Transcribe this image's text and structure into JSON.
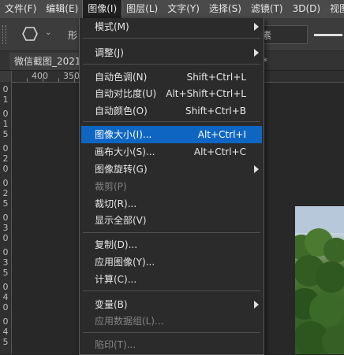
{
  "menubar": {
    "items": [
      "文件(F)",
      "编辑(E)",
      "图像(I)",
      "图层(L)",
      "文字(Y)",
      "选择(S)",
      "滤镜(T)",
      "3D(D)",
      "视图"
    ]
  },
  "options_bar": {
    "label_left": "形",
    "label_right": "素"
  },
  "document_tab": {
    "title": "微信截图_2021",
    "right_mark": "*"
  },
  "ruler": {
    "top": [
      "400",
      "350"
    ],
    "left": [
      "0",
      "1",
      "0",
      "1",
      "5",
      "0",
      "2",
      "0",
      "0",
      "2",
      "5",
      "0",
      "3",
      "0",
      "0",
      "3",
      "5",
      "0",
      "4",
      "0",
      "0",
      "4",
      "5",
      "0",
      "5",
      "0",
      "0",
      "5",
      "5",
      "0",
      "6",
      "0",
      "0"
    ]
  },
  "image_menu": {
    "items": [
      {
        "label": "模式(M)",
        "shortcut": "",
        "submenu": true,
        "disabled": false
      },
      {
        "label": "调整(J)",
        "shortcut": "",
        "submenu": true,
        "disabled": false
      },
      {
        "label": "自动色调(N)",
        "shortcut": "Shift+Ctrl+L",
        "submenu": false,
        "disabled": false
      },
      {
        "label": "自动对比度(U)",
        "shortcut": "Alt+Shift+Ctrl+L",
        "submenu": false,
        "disabled": false
      },
      {
        "label": "自动颜色(O)",
        "shortcut": "Shift+Ctrl+B",
        "submenu": false,
        "disabled": false
      },
      {
        "label": "图像大小(I)...",
        "shortcut": "Alt+Ctrl+I",
        "submenu": false,
        "disabled": false,
        "highlighted": true
      },
      {
        "label": "画布大小(S)...",
        "shortcut": "Alt+Ctrl+C",
        "submenu": false,
        "disabled": false
      },
      {
        "label": "图像旋转(G)",
        "shortcut": "",
        "submenu": true,
        "disabled": false
      },
      {
        "label": "裁剪(P)",
        "shortcut": "",
        "submenu": false,
        "disabled": true
      },
      {
        "label": "裁切(R)...",
        "shortcut": "",
        "submenu": false,
        "disabled": false
      },
      {
        "label": "显示全部(V)",
        "shortcut": "",
        "submenu": false,
        "disabled": false
      },
      {
        "label": "复制(D)...",
        "shortcut": "",
        "submenu": false,
        "disabled": false
      },
      {
        "label": "应用图像(Y)...",
        "shortcut": "",
        "submenu": false,
        "disabled": false
      },
      {
        "label": "计算(C)...",
        "shortcut": "",
        "submenu": false,
        "disabled": false
      },
      {
        "label": "变量(B)",
        "shortcut": "",
        "submenu": true,
        "disabled": false
      },
      {
        "label": "应用数据组(L)...",
        "shortcut": "",
        "submenu": false,
        "disabled": true
      },
      {
        "label": "陷印(T)...",
        "shortcut": "",
        "submenu": false,
        "disabled": true
      }
    ]
  },
  "colors": {
    "highlight": "#0f66c2",
    "menubar": "#4a4a4a",
    "menu_bg": "#2b2b2b",
    "workspace": "#262626"
  }
}
